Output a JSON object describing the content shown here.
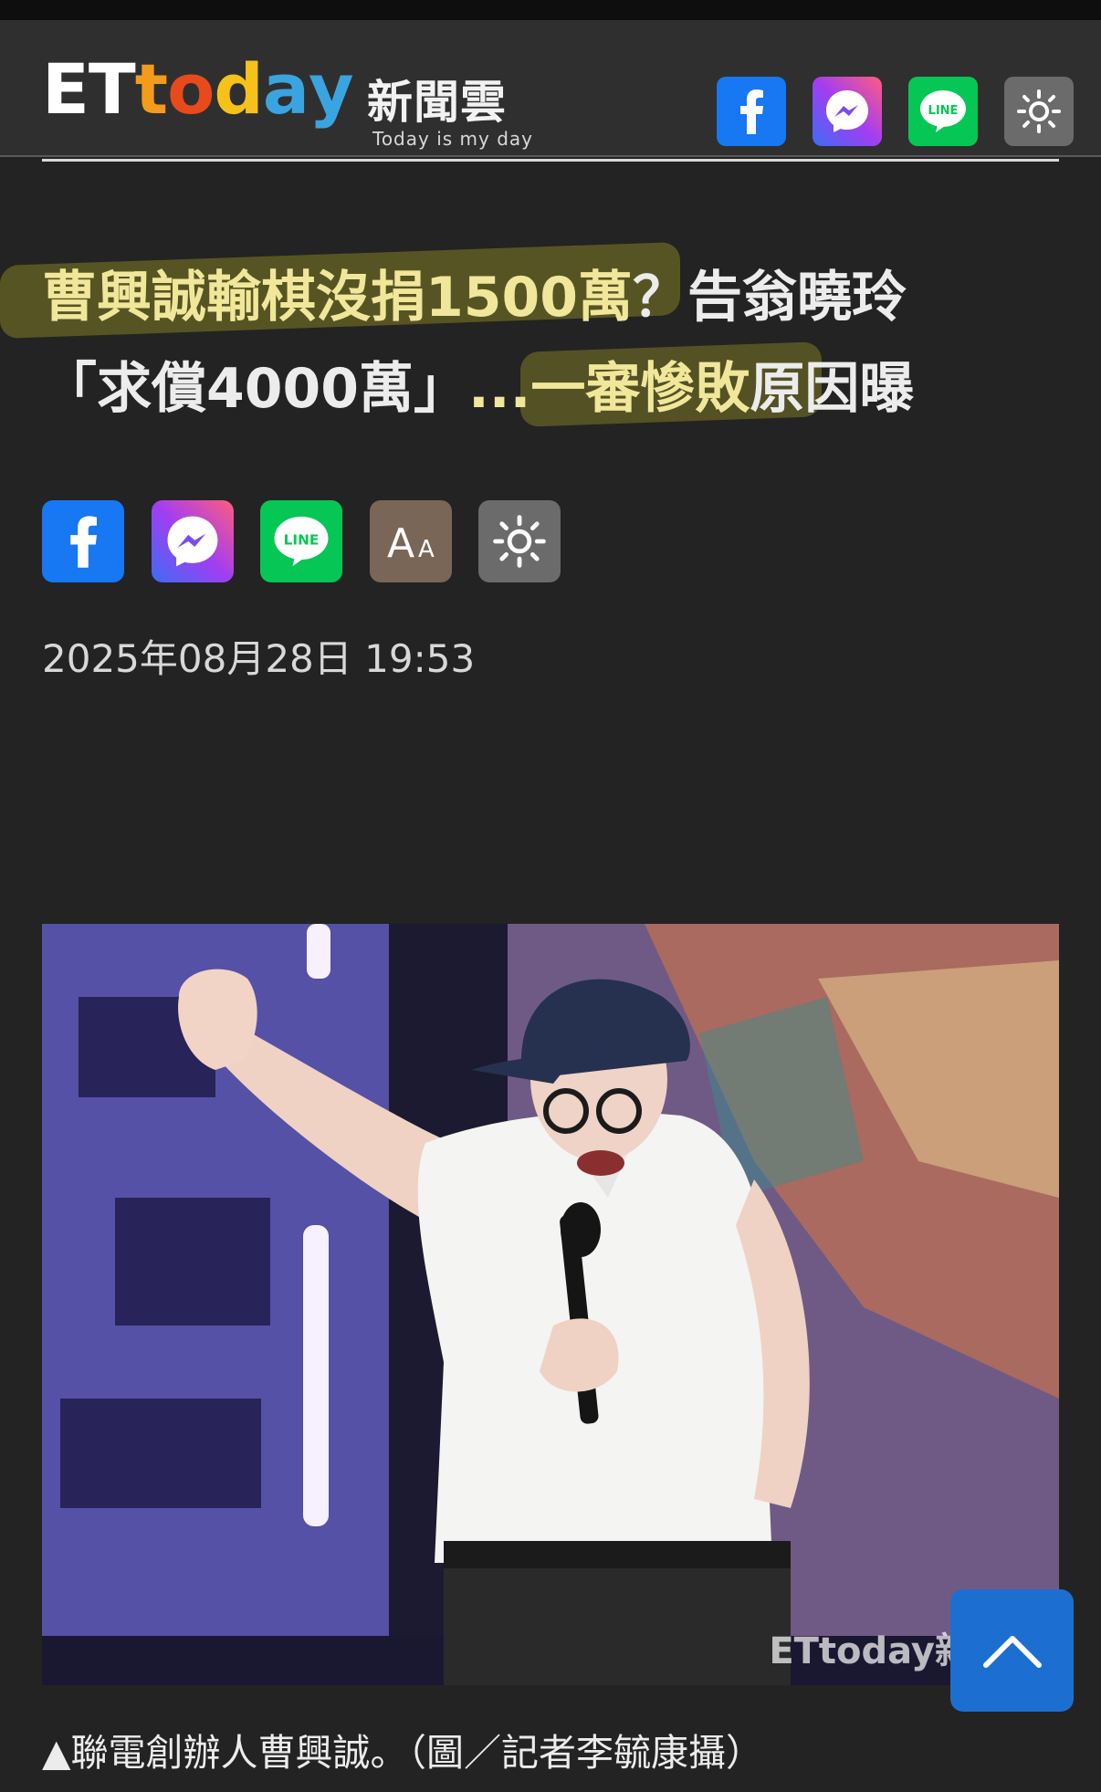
{
  "header": {
    "logo_letters": [
      "E",
      "T",
      "t",
      "o",
      "d",
      "a",
      "y"
    ],
    "logo_cn": "新聞雲",
    "logo_tagline": "Today is my day",
    "share_icons": [
      "facebook-icon",
      "messenger-icon",
      "line-icon",
      "brightness-icon"
    ]
  },
  "article": {
    "title_hl1": "曹興誠輸棋沒捐1500萬",
    "title_part1": "？告翁曉玲",
    "title_part2": "「求償4000萬」",
    "title_hl2": "...一審慘敗",
    "title_part3": "原因曝",
    "toolbar": {
      "line_label": "LINE",
      "font_label_big": "A",
      "font_label_small": "A"
    },
    "date": "2025年08月28日 19:53",
    "photo_watermark": "ETtoday新聞雲",
    "caption": "▲聯電創辦人曹興誠。（圖／記者李毓康攝）"
  },
  "colors": {
    "page_bg": "#232323",
    "header_bg": "#2f2f2f",
    "facebook": "#1877f2",
    "line": "#06c755",
    "highlight_text": "#f1e79a",
    "back_to_top": "#1c6fd0"
  },
  "logo_colors": [
    "#ffffff",
    "#ffffff",
    "#f39b1b",
    "#e84a1c",
    "#f6c21a",
    "#3aa4e0",
    "#3aa4e0"
  ]
}
